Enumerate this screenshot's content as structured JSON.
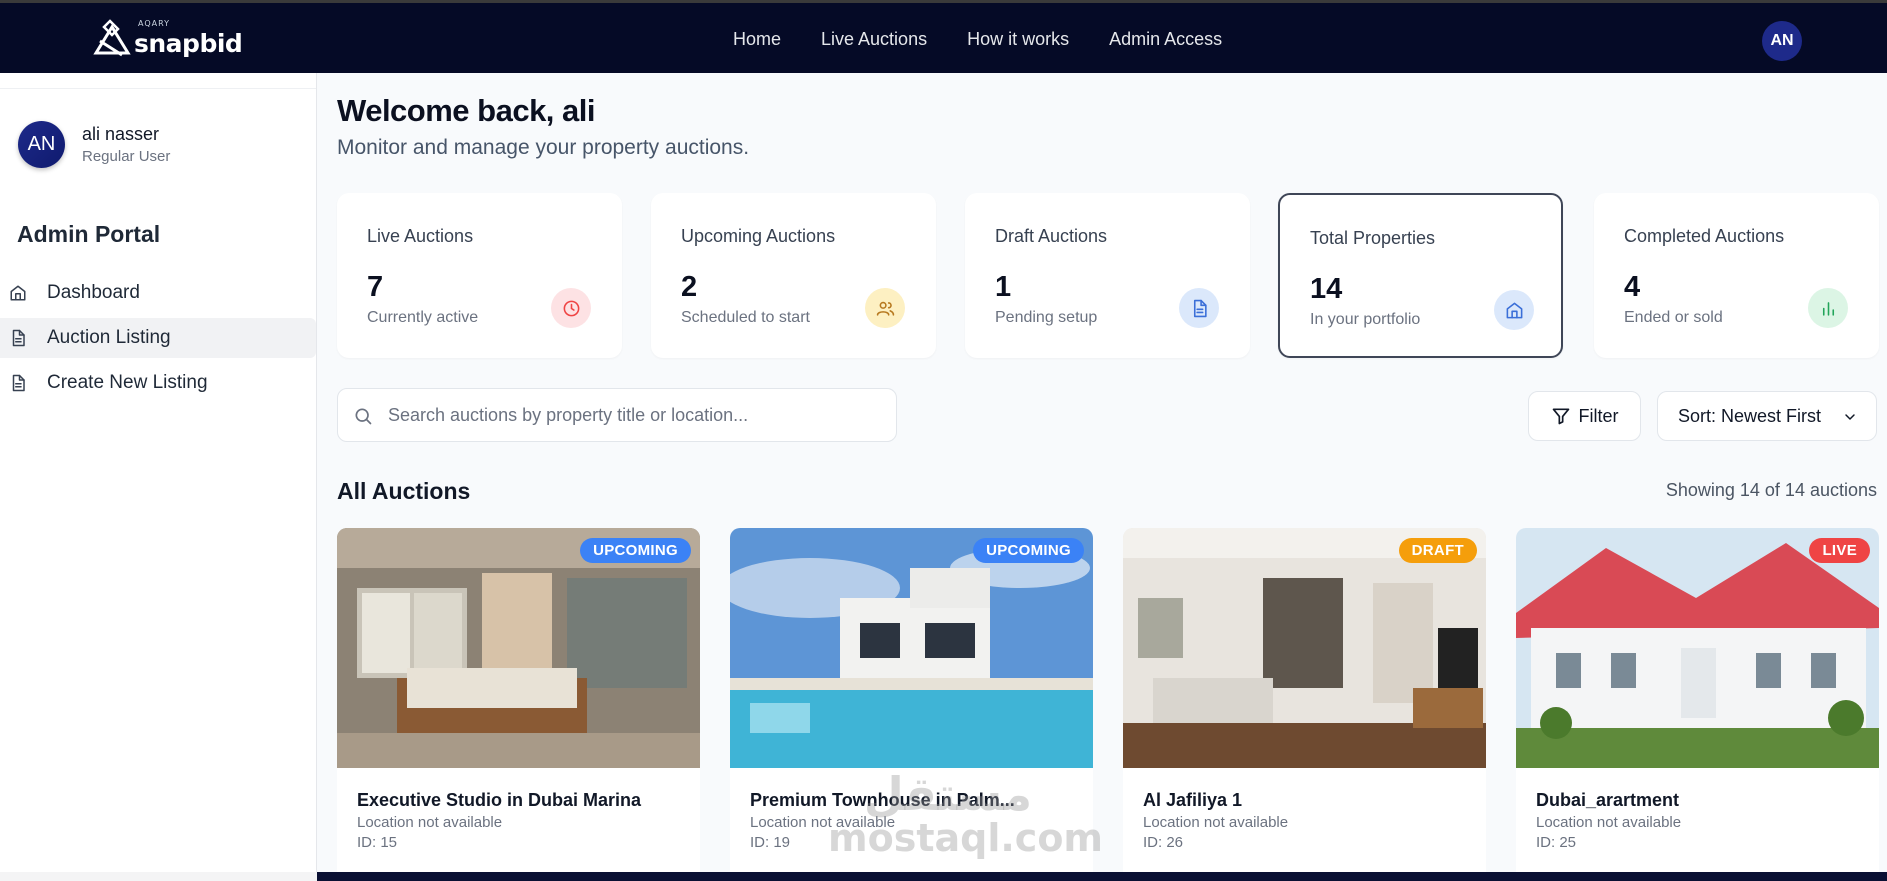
{
  "brand": {
    "small": "AQARY",
    "name": "snapbid"
  },
  "nav": {
    "items": [
      "Home",
      "Live Auctions",
      "How it works",
      "Admin Access"
    ]
  },
  "top_avatar": "AN",
  "user": {
    "initials": "AN",
    "name": "ali nasser",
    "role": "Regular User"
  },
  "sidebar": {
    "title": "Admin Portal",
    "items": [
      {
        "label": "Dashboard",
        "icon": "home-icon"
      },
      {
        "label": "Auction Listing",
        "icon": "document-icon",
        "active": true
      },
      {
        "label": "Create New Listing",
        "icon": "document-icon"
      }
    ]
  },
  "header": {
    "title": "Welcome back, ali",
    "subtitle": "Monitor and manage your property auctions."
  },
  "stats": [
    {
      "title": "Live Auctions",
      "value": "7",
      "sub": "Currently active",
      "icon": "clock-icon",
      "color": "#ef4444",
      "bg": "#fde2e4"
    },
    {
      "title": "Upcoming Auctions",
      "value": "2",
      "sub": "Scheduled to start",
      "icon": "users-icon",
      "color": "#b7791f",
      "bg": "#fdf0c2"
    },
    {
      "title": "Draft Auctions",
      "value": "1",
      "sub": "Pending setup",
      "icon": "file-icon",
      "color": "#3b6fd8",
      "bg": "#dbe8fb"
    },
    {
      "title": "Total Properties",
      "value": "14",
      "sub": "In your portfolio",
      "icon": "home-icon",
      "color": "#3b6fd8",
      "bg": "#dbe8fb",
      "selected": true
    },
    {
      "title": "Completed Auctions",
      "value": "4",
      "sub": "Ended or sold",
      "icon": "bar-chart-icon",
      "color": "#22a55a",
      "bg": "#dcf5e5"
    }
  ],
  "search": {
    "placeholder": "Search auctions by property title or location...",
    "value": ""
  },
  "filter_label": "Filter",
  "sort": {
    "label": "Sort: Newest First"
  },
  "listing": {
    "title": "All Auctions",
    "showing": "Showing 14 of 14 auctions"
  },
  "cards": [
    {
      "title": "Executive Studio in Dubai Marina",
      "location": "Location not available",
      "id": "ID: 15",
      "status": "UPCOMING",
      "status_color": "#3b82f6"
    },
    {
      "title": "Premium Townhouse in Palm...",
      "location": "Location not available",
      "id": "ID: 19",
      "status": "UPCOMING",
      "status_color": "#3b82f6"
    },
    {
      "title": "Al Jafiliya 1",
      "location": "Location not available",
      "id": "ID: 26",
      "status": "DRAFT",
      "status_color": "#f59e0b"
    },
    {
      "title": "Dubai_arartment",
      "location": "Location not available",
      "id": "ID: 25",
      "status": "LIVE",
      "status_color": "#ef4444"
    }
  ],
  "watermark": {
    "ar": "مستقل",
    "en": "mostaql.com"
  },
  "colors": {
    "nav_bg": "#050a26",
    "accent": "#1e2a8a",
    "page_bg": "#f8fafc"
  }
}
